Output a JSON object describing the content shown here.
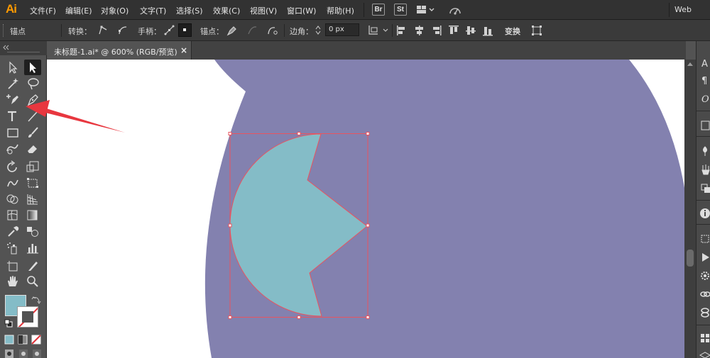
{
  "app": {
    "logo": "Ai",
    "workspace": "Web"
  },
  "menu": {
    "items": [
      "文件(F)",
      "编辑(E)",
      "对象(O)",
      "文字(T)",
      "选择(S)",
      "效果(C)",
      "视图(V)",
      "窗口(W)",
      "帮助(H)"
    ],
    "bridge": "Br",
    "stock": "St"
  },
  "control": {
    "anchor_label": "锚点",
    "convert_label": "转换：",
    "handles_label": "手柄：",
    "anchor_points_label": "锚点：",
    "corner_label": "边角：",
    "corner_value": "0 px",
    "transform_label": "变换"
  },
  "document": {
    "tab_title": "未标题-1.ai* @ 600% (RGB/预览)",
    "close_glyph": "×"
  },
  "colors": {
    "fill": "#84bcc7",
    "background_circle": "#8381af",
    "selection": "#e8545f",
    "arrow": "#e8373f",
    "logo": "#ff9a00"
  },
  "icons": {
    "toolbar": [
      "selection-tool-icon",
      "direct-selection-tool-icon",
      "magic-wand-icon",
      "lasso-icon",
      "add-anchor-point-icon",
      "pen-tool-icon",
      "type-tool-icon",
      "line-segment-icon",
      "rectangle-tool-icon",
      "paintbrush-icon",
      "shaper-icon",
      "eraser-icon",
      "rotate-icon",
      "scale-icon",
      "warp-icon",
      "free-transform-icon",
      "shape-builder-icon",
      "perspective-grid-icon",
      "mesh-icon",
      "gradient-icon",
      "eyedropper-icon",
      "blend-icon",
      "symbol-sprayer-icon",
      "column-graph-icon",
      "artboard-icon",
      "slice-icon",
      "hand-icon",
      "zoom-icon"
    ]
  }
}
